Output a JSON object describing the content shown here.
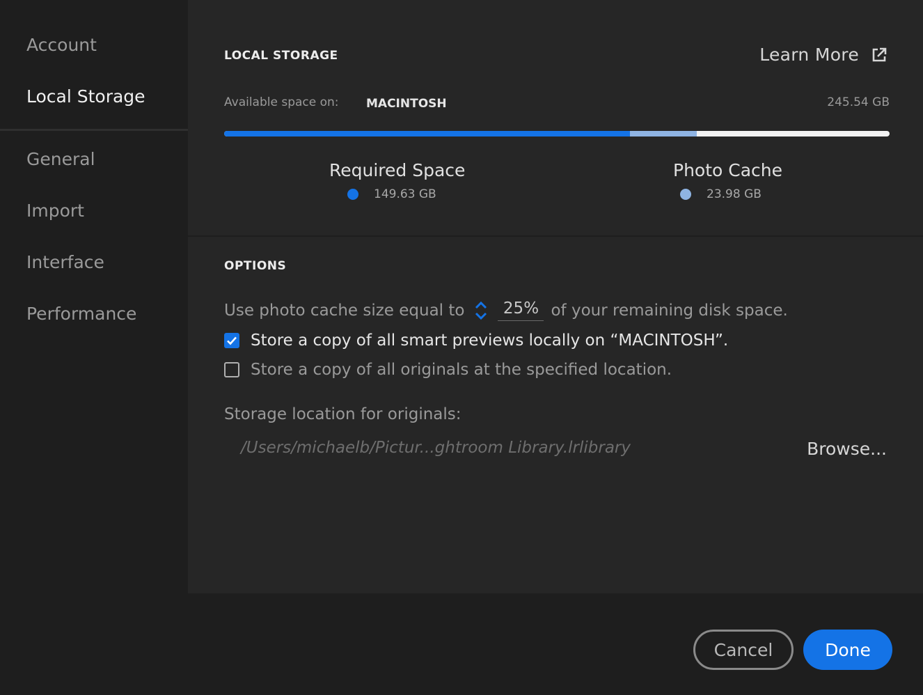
{
  "sidebar": {
    "items": [
      {
        "label": "Account"
      },
      {
        "label": "Local Storage",
        "active": true
      },
      {
        "label": "General"
      },
      {
        "label": "Import"
      },
      {
        "label": "Interface"
      },
      {
        "label": "Performance"
      }
    ]
  },
  "storage": {
    "title": "LOCAL STORAGE",
    "learn_more": "Learn More",
    "learn_more_icon": "external-link-icon",
    "available_label": "Available space on:",
    "drive": "MACINTOSH",
    "available_size": "245.54 GB",
    "usage_bar": {
      "required_fraction": 0.61,
      "cache_fraction": 0.1,
      "required_color": "#1473e6",
      "cache_color": "#8fb4e3",
      "free_color": "#f2f2f2"
    },
    "required": {
      "label": "Required Space",
      "value": "149.63 GB",
      "color": "#1473e6"
    },
    "cache": {
      "label": "Photo Cache",
      "value": "23.98 GB",
      "color": "#8fb4e3"
    }
  },
  "options": {
    "title": "OPTIONS",
    "cache_prefix": "Use photo cache size equal to",
    "cache_percent": "25%",
    "cache_suffix": "of your remaining disk space.",
    "smart_previews": {
      "label": "Store a copy of all smart previews locally on “MACINTOSH”.",
      "checked": true
    },
    "originals": {
      "label": "Store a copy of all originals at the specified location.",
      "checked": false
    },
    "location_label": "Storage location for originals:",
    "location_path": "/Users/michaelb/Pictur...ghtroom Library.lrlibrary",
    "browse": "Browse..."
  },
  "footer": {
    "cancel": "Cancel",
    "done": "Done"
  }
}
